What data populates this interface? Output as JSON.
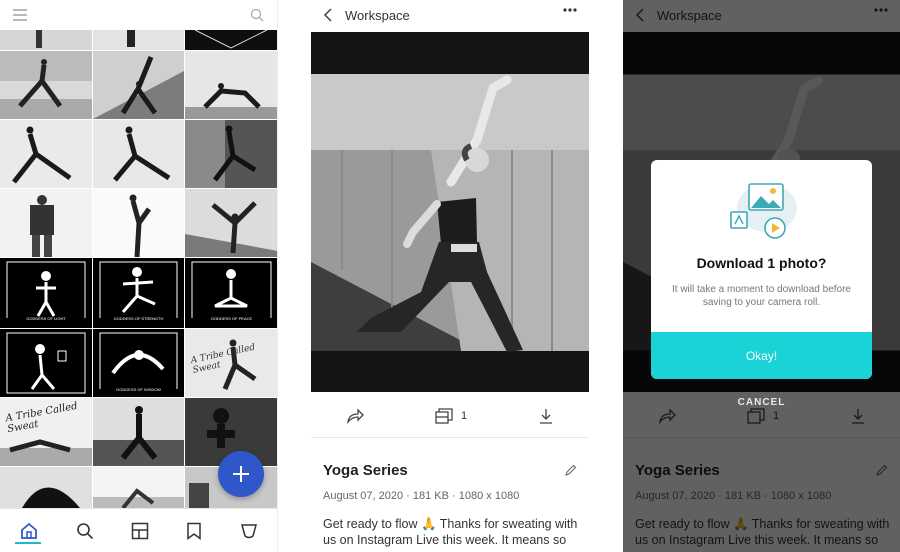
{
  "grid_panel": {
    "tabs": [
      "home-icon",
      "search-icon",
      "board-icon",
      "bookmark-icon",
      "cloud-icon"
    ],
    "tiles": [
      {
        "caption": "GODDESS OF LIGHT"
      },
      {
        "caption": "GODDESS OF STRENGTH"
      },
      {
        "caption": "GODDESS OF PEACE"
      },
      {
        "caption": "GODDESS OF WISDOM"
      },
      {
        "caption": "A Tribe Called Sweat"
      },
      {
        "caption": "A Tribe Called Sweat"
      }
    ]
  },
  "detail": {
    "header_title": "Workspace",
    "photo_count": "1",
    "title": "Yoga Series",
    "meta": "August 07, 2020 · 181 KB · 1080 x 1080",
    "description": "Get ready to flow 🙏 Thanks for sweating with us on Instagram Live this week. It means so"
  },
  "dialog": {
    "title": "Download 1 photo?",
    "message": "It will take a moment to download before saving to your camera roll.",
    "confirm_label": "Okay!",
    "cancel_label": "CANCEL"
  },
  "colors": {
    "fab": "#2f57c9",
    "accent": "#19d3d7",
    "tab_indicator": "#21b8c9"
  }
}
